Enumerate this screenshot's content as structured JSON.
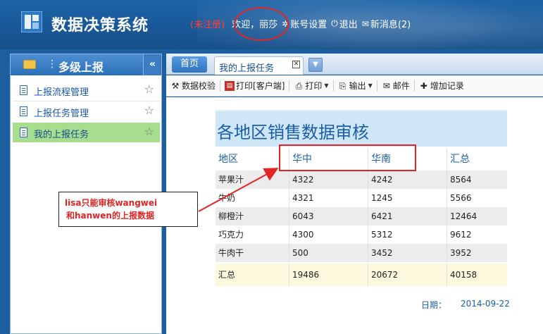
{
  "header": {
    "app_title": "数据决策系统",
    "unregistered": "(未注册)",
    "welcome": "欢迎，丽莎",
    "account_settings": "账号设置",
    "logout": "退出",
    "new_messages": "新消息(2)"
  },
  "sidebar": {
    "title": "多级上报",
    "collapse_glyph": "«",
    "items": [
      {
        "label": "上报流程管理",
        "active": false
      },
      {
        "label": "上报任务管理",
        "active": false
      },
      {
        "label": "我的上报任务",
        "active": true
      }
    ]
  },
  "tabs": {
    "home": "首页",
    "active": "我的上报任务"
  },
  "toolbar": {
    "data_check": "数据校验",
    "print_client": "打印[客户端]",
    "print": "打印",
    "export": "输出",
    "mail": "邮件",
    "add_record": "增加记录"
  },
  "report": {
    "title": "各地区销售数据审核",
    "columns": [
      "地区",
      "华中",
      "华南",
      "汇总"
    ],
    "rows": [
      [
        "苹果汁",
        "4322",
        "4242",
        "8564"
      ],
      [
        "牛奶",
        "4321",
        "1245",
        "5566"
      ],
      [
        "柳橙汁",
        "6043",
        "6421",
        "12464"
      ],
      [
        "巧克力",
        "4300",
        "5312",
        "9612"
      ],
      [
        "牛肉干",
        "500",
        "3452",
        "3952"
      ]
    ],
    "total": [
      "汇总",
      "19486",
      "20672",
      "40158"
    ],
    "date_label": "日期：",
    "date_value": "2014-09-22"
  },
  "annotation": {
    "line1": "lisa只能审核wangwei",
    "line2": "和hanwen的上报数据",
    "color": "#e32424"
  }
}
